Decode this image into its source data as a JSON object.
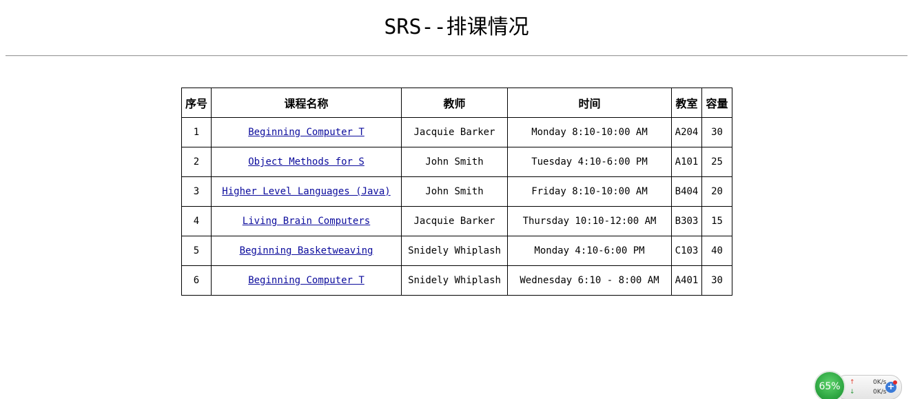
{
  "page": {
    "title": "SRS--排课情况"
  },
  "table": {
    "headers": {
      "index": "序号",
      "course": "课程名称",
      "teacher": "教师",
      "time": "时间",
      "room": "教室",
      "capacity": "容量"
    },
    "rows": [
      {
        "index": "1",
        "course": "Beginning Computer T",
        "teacher": "Jacquie Barker",
        "time": "Monday  8:10-10:00 AM",
        "room": "A204",
        "capacity": "30"
      },
      {
        "index": "2",
        "course": "Object Methods for S",
        "teacher": "John Smith",
        "time": "Tuesday  4:10-6:00 PM",
        "room": "A101",
        "capacity": "25"
      },
      {
        "index": "3",
        "course": "Higher Level Languages (Java)",
        "teacher": "John Smith",
        "time": "Friday  8:10-10:00 AM",
        "room": "B404",
        "capacity": "20"
      },
      {
        "index": "4",
        "course": "Living Brain Computers",
        "teacher": "Jacquie Barker",
        "time": "Thursday  10:10-12:00 AM",
        "room": "B303",
        "capacity": "15"
      },
      {
        "index": "5",
        "course": "Beginning Basketweaving",
        "teacher": "Snidely Whiplash",
        "time": "Monday  4:10-6:00 PM",
        "room": "C103",
        "capacity": "40"
      },
      {
        "index": "6",
        "course": "Beginning Computer T",
        "teacher": "Snidely Whiplash",
        "time": "Wednesday  6:10 - 8:00 AM",
        "room": "A401",
        "capacity": "30"
      }
    ]
  },
  "net_monitor": {
    "usage": "65%",
    "up_rate": "0K/s",
    "down_rate": "0K/s",
    "up_icon": "arrow-up-icon",
    "down_icon": "arrow-down-icon",
    "plus_icon": "plus-icon"
  },
  "colors": {
    "link": "#0b0b9c",
    "gauge": "#2fa843"
  }
}
